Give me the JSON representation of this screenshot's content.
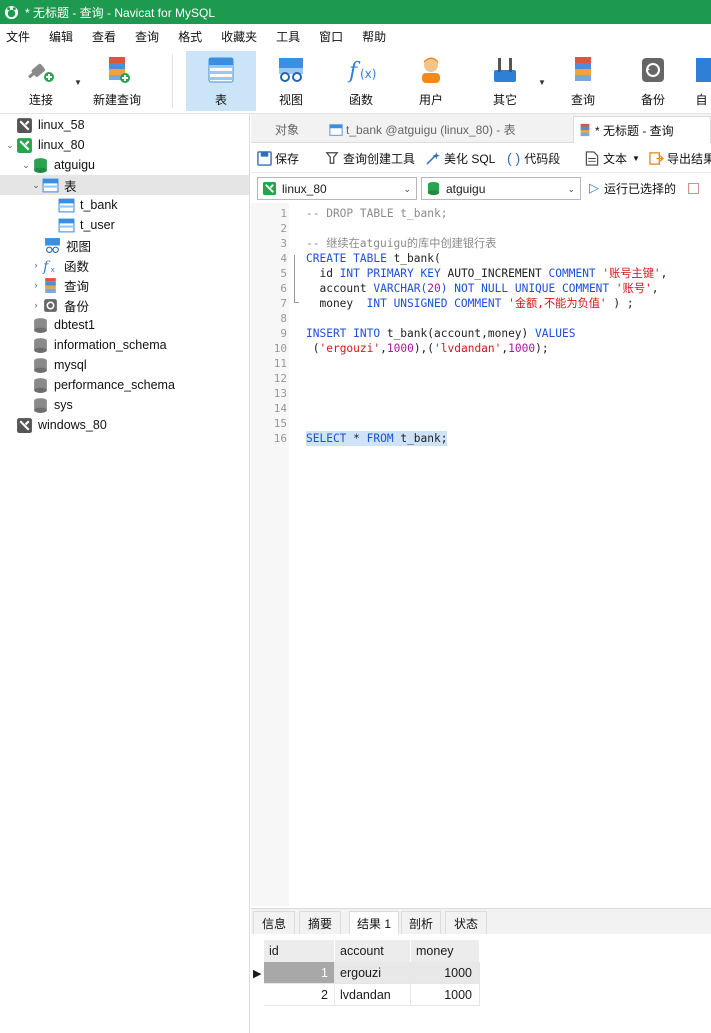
{
  "window": {
    "title": "* 无标题 - 查询 - Navicat for MySQL"
  },
  "menu": [
    "文件",
    "编辑",
    "查看",
    "查询",
    "格式",
    "收藏夹",
    "工具",
    "窗口",
    "帮助"
  ],
  "toolbar": {
    "connect": "连接",
    "new_query": "新建查询",
    "table": "表",
    "view": "视图",
    "function": "函数",
    "user": "用户",
    "other": "其它",
    "query": "查询",
    "backup": "备份",
    "auto": "自"
  },
  "tree": {
    "linux_58": "linux_58",
    "linux_80": "linux_80",
    "atguigu": "atguigu",
    "tables": "表",
    "t_bank": "t_bank",
    "t_user": "t_user",
    "views": "视图",
    "functions": "函数",
    "queries": "查询",
    "backups": "备份",
    "dbtest1": "dbtest1",
    "information_schema": "information_schema",
    "mysql": "mysql",
    "performance_schema": "performance_schema",
    "sys": "sys",
    "windows_80": "windows_80"
  },
  "tabs": {
    "objects": "对象",
    "t_bank_tab": "t_bank @atguigu (linux_80) - 表",
    "query_tab": "* 无标题 - 查询"
  },
  "editor_toolbar": {
    "save": "保存",
    "query_builder": "查询创建工具",
    "beautify": "美化 SQL",
    "snippets": "代码段",
    "text": "文本",
    "export": "导出结果"
  },
  "selectors": {
    "connection": "linux_80",
    "database": "atguigu",
    "run_selected": "运行已选择的"
  },
  "code": {
    "l1": "-- DROP TABLE t_bank;",
    "l3": "-- 继续在atguigu的库中创建银行表",
    "l4_kw1": "CREATE TABLE",
    "l4_rest": " t_bank(",
    "l5_a": "  id ",
    "l5_kw1": "INT PRIMARY KEY",
    "l5_b": " AUTO_INCREMENT ",
    "l5_kw2": "COMMENT",
    "l5_c": " ",
    "l5_str": "'账号主键'",
    "l5_d": ",",
    "l6_a": "  account ",
    "l6_kw1": "VARCHAR(",
    "l6_num": "20",
    "l6_kw1b": ")",
    "l6_b": " ",
    "l6_kw2": "NOT NULL UNIQUE COMMENT",
    "l6_c": " ",
    "l6_str": "'账号'",
    "l6_d": ",",
    "l7_a": "  money  ",
    "l7_kw1": "INT UNSIGNED COMMENT",
    "l7_b": " ",
    "l7_str": "'金额,不能为负值'",
    "l7_c": " ) ;",
    "l9_kw1": "INSERT INTO",
    "l9_a": " t_bank(account,money) ",
    "l9_kw2": "VALUES",
    "l10_a": " (",
    "l10_s1": "'ergouzi'",
    "l10_b": ",",
    "l10_n1": "1000",
    "l10_c": "),(",
    "l10_s2": "'lvdandan'",
    "l10_d": ",",
    "l10_n2": "1000",
    "l10_e": ");",
    "l16_kw1": "SELECT",
    "l16_a": " * ",
    "l16_kw2": "FROM",
    "l16_b": " t_bank;"
  },
  "line_numbers": [
    "1",
    "2",
    "3",
    "4",
    "5",
    "6",
    "7",
    "8",
    "9",
    "10",
    "11",
    "12",
    "13",
    "14",
    "15",
    "16"
  ],
  "result_tabs": [
    "信息",
    "摘要",
    "结果 1",
    "剖析",
    "状态"
  ],
  "result": {
    "columns": [
      "id",
      "account",
      "money"
    ],
    "rows": [
      [
        "1",
        "ergouzi",
        "1000"
      ],
      [
        "2",
        "lvdandan",
        "1000"
      ]
    ]
  },
  "colors": {
    "titlebar": "#1d9a4f",
    "keyword": "#1d4fdb",
    "string": "#d5161b",
    "number": "#a8179c",
    "selection": "#cfe3f8"
  }
}
